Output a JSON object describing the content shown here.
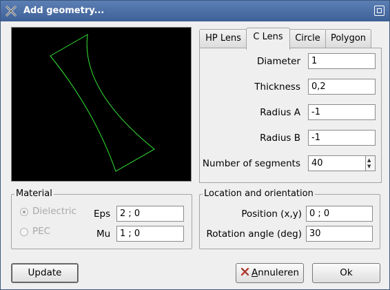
{
  "window": {
    "title": "Add geometry..."
  },
  "tabs": [
    {
      "label": "HP Lens"
    },
    {
      "label": "C Lens"
    },
    {
      "label": "Circle"
    },
    {
      "label": "Polygon"
    }
  ],
  "clens": {
    "diameter_label": "Diameter",
    "diameter_value": "1",
    "thickness_label": "Thickness",
    "thickness_value": "0,2",
    "radius_a_label": "Radius A",
    "radius_a_value": "-1",
    "radius_b_label": "Radius B",
    "radius_b_value": "-1",
    "segments_label": "Number of segments",
    "segments_value": "40"
  },
  "material": {
    "title": "Material",
    "dielectric_label": "Dielectric",
    "pec_label": "PEC",
    "eps_label": "Eps",
    "eps_value": "2 ; 0",
    "mu_label": "Mu",
    "mu_value": "1 ; 0"
  },
  "location": {
    "title": "Location and orientation",
    "position_label": "Position (x,y)",
    "position_value": "0 ; 0",
    "rotation_label": "Rotation angle (deg)",
    "rotation_value": "30"
  },
  "buttons": {
    "update": "Update",
    "cancel_pre": "",
    "cancel_mnemonic": "A",
    "cancel_post": "nnuleren",
    "ok": "Ok"
  },
  "colors": {
    "preview_bg": "#000000",
    "shape_stroke": "#33e633",
    "titlebar": "#4a6ea5"
  },
  "icons": {
    "app": "app-x-icon",
    "maximize": "maximize-icon",
    "cancel": "cancel-x-icon"
  }
}
